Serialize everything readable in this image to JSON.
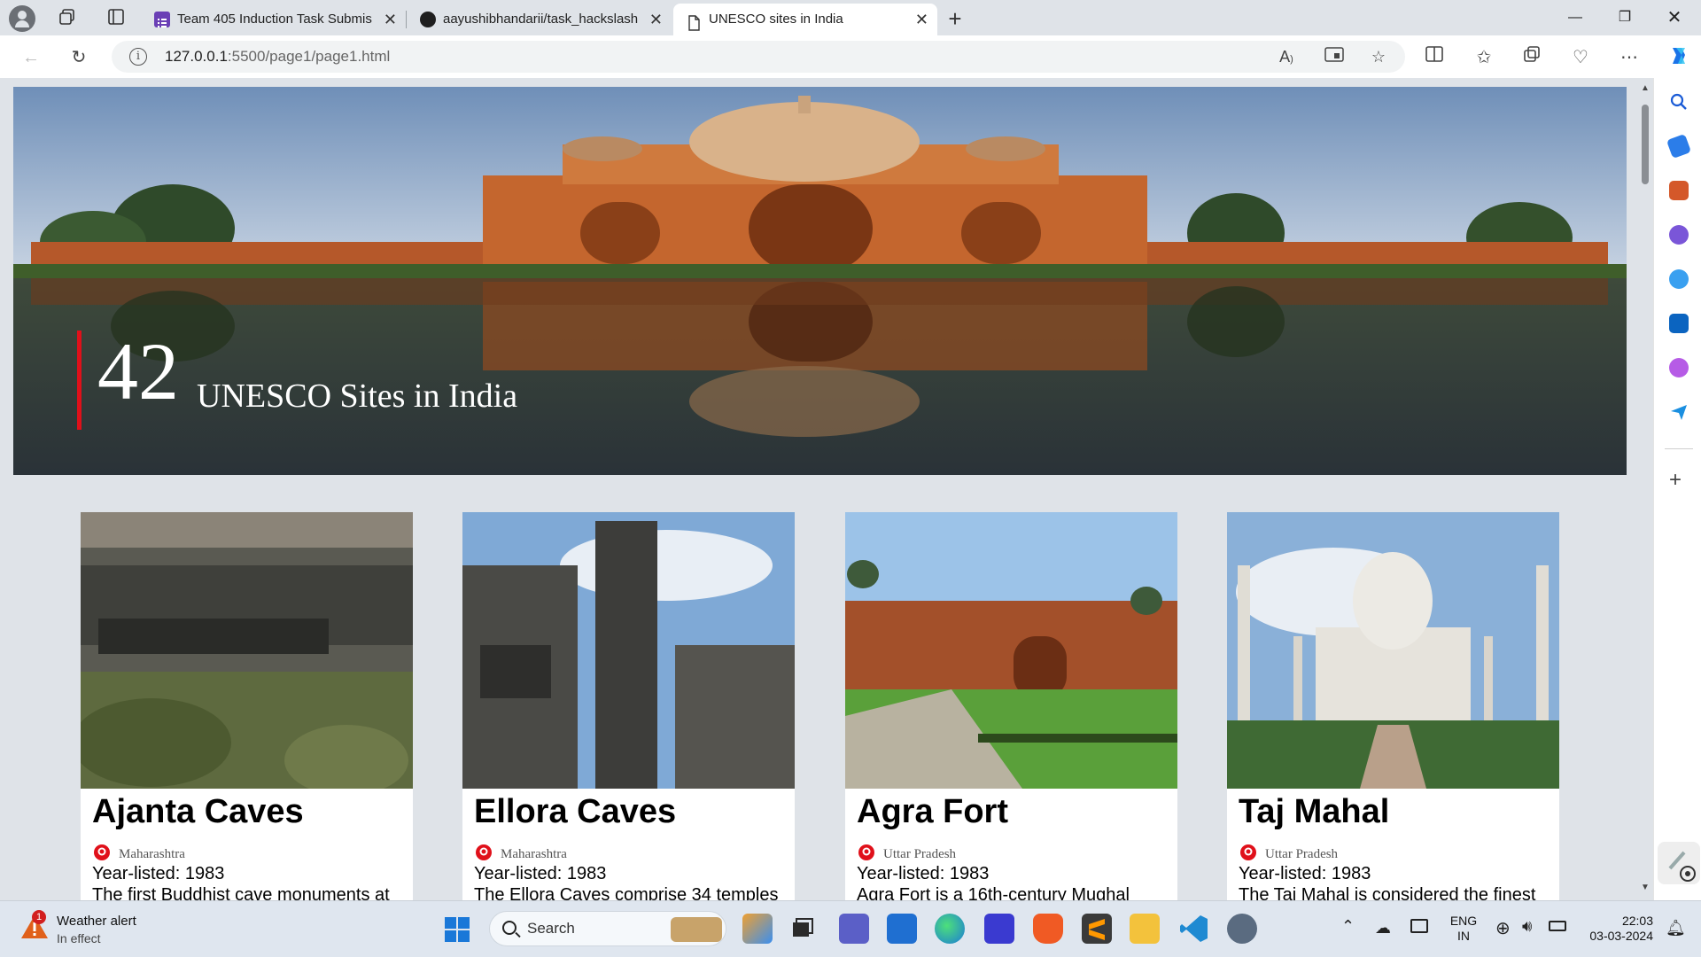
{
  "browser": {
    "tabs": [
      {
        "title": "Team 405 Induction Task Submis",
        "icon": "forms-icon",
        "active": false
      },
      {
        "title": "aayushibhandarii/task_hackslash",
        "icon": "github-icon",
        "active": false
      },
      {
        "title": "UNESCO sites in India",
        "icon": "page-icon",
        "active": true
      }
    ],
    "new_tab_label": "+",
    "url_host": "127.0.0.1",
    "url_path": ":5500/page1/page1.html"
  },
  "page": {
    "hero": {
      "count": "42",
      "title": "UNESCO Sites in India"
    },
    "cards": [
      {
        "name": "Ajanta Caves",
        "state": "Maharashtra",
        "year": "Year-listed: 1983",
        "desc": "The first Buddhist cave monuments at"
      },
      {
        "name": "Ellora Caves",
        "state": "Maharashtra",
        "year": "Year-listed: 1983",
        "desc": "The Ellora Caves comprise 34 temples"
      },
      {
        "name": "Agra Fort",
        "state": "Uttar Pradesh",
        "year": "Year-listed: 1983",
        "desc": "Agra Fort is a 16th-century Mughal"
      },
      {
        "name": "Taj Mahal",
        "state": "Uttar Pradesh",
        "year": "Year-listed: 1983",
        "desc": "The Taj Mahal is considered the finest"
      }
    ]
  },
  "taskbar": {
    "weather_title": "Weather alert",
    "weather_sub": "In effect",
    "weather_badge": "1",
    "search_label": "Search",
    "lang_top": "ENG",
    "lang_bottom": "IN",
    "time": "22:03",
    "date": "03-03-2024"
  },
  "colors": {
    "accent_bar": "#e0101a",
    "pin_red": "#e0101a"
  }
}
